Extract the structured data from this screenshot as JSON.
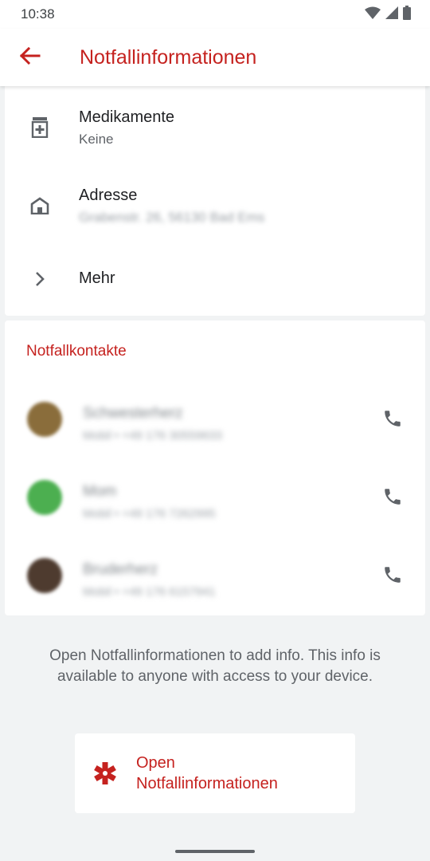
{
  "status": {
    "time": "10:38"
  },
  "header": {
    "title": "Notfallinformationen"
  },
  "info": {
    "medication": {
      "title": "Medikamente",
      "value": "Keine"
    },
    "address": {
      "title": "Adresse",
      "value": "Grabenstr. 26, 56130 Bad Ems"
    },
    "more": {
      "title": "Mehr"
    }
  },
  "contacts": {
    "header": "Notfallkontakte",
    "items": [
      {
        "name": "Schwesterherz",
        "number": "Mobil • +49 176 30559633",
        "avatar_color": "#8a6d3b"
      },
      {
        "name": "Mom",
        "number": "Mobil • +49 176 7262995",
        "avatar_color": "#4caf50"
      },
      {
        "name": "Bruderherz",
        "number": "Mobil • +49 176 6157941",
        "avatar_color": "#4e3b2f"
      }
    ]
  },
  "footer": {
    "text": "Open Notfallinformationen to add info. This info is available to anyone with access to your device.",
    "button_line1": "Open",
    "button_line2": "Notfallinformationen"
  },
  "colors": {
    "accent": "#c5221f"
  }
}
